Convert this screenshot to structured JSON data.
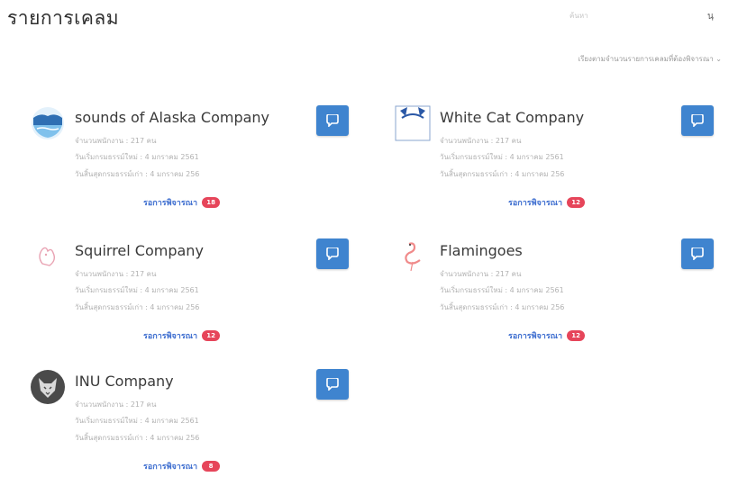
{
  "header": {
    "title": "รายการเคลม",
    "search_placeholder": "ค้นหา",
    "user_label": "นฺ"
  },
  "sort_label": "เรียงตามจำนวนรายการเคลมที่ต้องพิจารณา",
  "cards": [
    {
      "name": "sounds of Alaska Company",
      "employees": "จำนวนพนักงาน : 217 คน",
      "start": "วันเริ่มกรมธรรม์ใหม่ : 4 มกราคม 2561",
      "end": "วันสิ้นสุดกรมธรรม์เก่า : 4 มกราคม 256",
      "pending_label": "รอการพิจารณา",
      "pending_count": "18",
      "logo": "alaska-logo"
    },
    {
      "name": "White Cat Company",
      "employees": "จำนวนพนักงาน : 217 คน",
      "start": "วันเริ่มกรมธรรม์ใหม่ : 4 มกราคม 2561",
      "end": "วันสิ้นสุดกรมธรรม์เก่า : 4 มกราคม 256",
      "pending_label": "รอการพิจารณา",
      "pending_count": "12",
      "logo": "white-cat-logo"
    },
    {
      "name": "Squirrel Company",
      "employees": "จำนวนพนักงาน : 217 คน",
      "start": "วันเริ่มกรมธรรม์ใหม่ : 4 มกราคม 2561",
      "end": "วันสิ้นสุดกรมธรรม์เก่า : 4 มกราคม 256",
      "pending_label": "รอการพิจารณา",
      "pending_count": "12",
      "logo": "squirrel-logo"
    },
    {
      "name": "Flamingoes",
      "employees": "จำนวนพนักงาน : 217 คน",
      "start": "วันเริ่มกรมธรรม์ใหม่ : 4 มกราคม 2561",
      "end": "วันสิ้นสุดกรมธรรม์เก่า : 4 มกราคม 256",
      "pending_label": "รอการพิจารณา",
      "pending_count": "12",
      "logo": "flamingo-logo"
    },
    {
      "name": "INU Company",
      "employees": "จำนวนพนักงาน : 217 คน",
      "start": "วันเริ่มกรมธรรม์ใหม่ : 4 มกราคม 2561",
      "end": "วันสิ้นสุดกรมธรรม์เก่า : 4 มกราคม 256",
      "pending_label": "รอการพิจารณา",
      "pending_count": "8",
      "logo": "inu-logo"
    }
  ],
  "colors": {
    "accent_button": "#3f84cf",
    "badge": "#e6455a",
    "link": "#3f6fd0"
  }
}
